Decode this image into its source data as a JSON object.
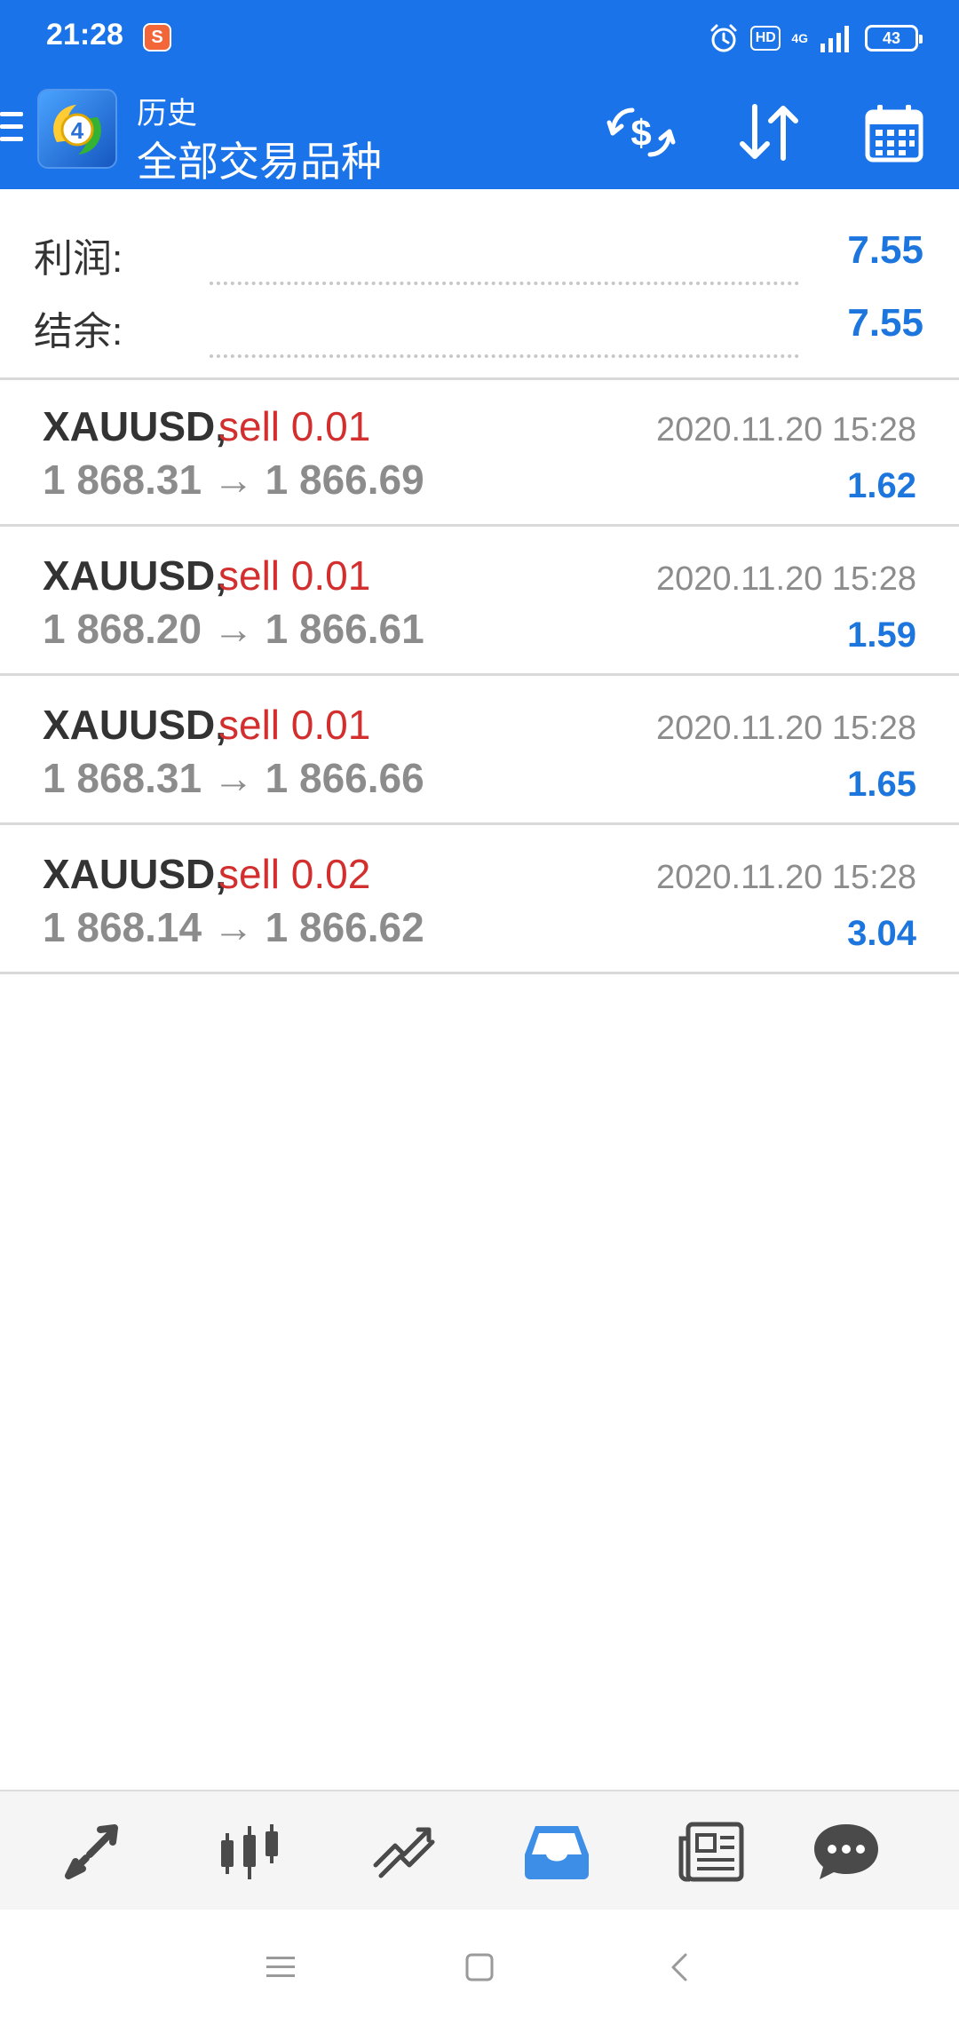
{
  "status_bar": {
    "time": "21:28",
    "app_badge": "S",
    "hd_label": "HD",
    "network_label": "4G",
    "battery": "43"
  },
  "toolbar": {
    "title_small": "历史",
    "title_big": "全部交易品种",
    "icons": [
      "currency-exchange-icon",
      "sort-icon",
      "calendar-icon"
    ]
  },
  "summary": {
    "profit_label": "利润:",
    "profit_value": "7.55",
    "balance_label": "结余:",
    "balance_value": "7.55"
  },
  "deals": [
    {
      "symbol": "XAUUSD,",
      "side": "sell 0.01",
      "prices": "1 868.31 → 1 866.69",
      "time": "2020.11.20 15:28",
      "profit": "1.62"
    },
    {
      "symbol": "XAUUSD,",
      "side": "sell 0.01",
      "prices": "1 868.20 → 1 866.61",
      "time": "2020.11.20 15:28",
      "profit": "1.59"
    },
    {
      "symbol": "XAUUSD,",
      "side": "sell 0.01",
      "prices": "1 868.31 → 1 866.66",
      "time": "2020.11.20 15:28",
      "profit": "1.65"
    },
    {
      "symbol": "XAUUSD,",
      "side": "sell 0.02",
      "prices": "1 868.14 → 1 866.62",
      "time": "2020.11.20 15:28",
      "profit": "3.04"
    }
  ],
  "tabs": [
    {
      "name": "quotes-tab-icon",
      "active": false
    },
    {
      "name": "chart-tab-icon",
      "active": false
    },
    {
      "name": "trade-tab-icon",
      "active": false
    },
    {
      "name": "history-tab-icon",
      "active": true
    },
    {
      "name": "news-tab-icon",
      "active": false
    },
    {
      "name": "chat-tab-icon",
      "active": false
    }
  ],
  "colors": {
    "primary": "#1a73e8",
    "sell": "#d32f2f",
    "profit": "#1c76dd",
    "muted": "#8c8c8c",
    "tab_active": "#3d8ee6",
    "tab_inactive": "#4a4a4a"
  }
}
